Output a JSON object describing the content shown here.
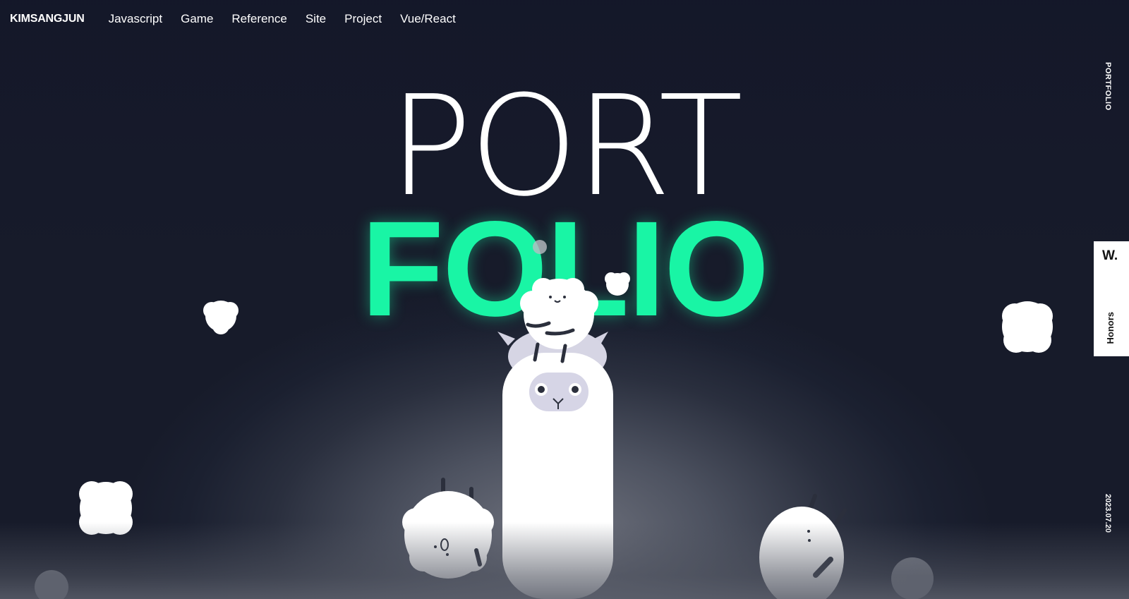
{
  "header": {
    "logo": "KIMSANGJUN",
    "nav": [
      "Javascript",
      "Game",
      "Reference",
      "Site",
      "Project",
      "Vue/React"
    ]
  },
  "side": {
    "portfolio_label": "PORTFOLIO",
    "date": "2023.07.20"
  },
  "honors": {
    "badge": "W.",
    "label": "Honors"
  },
  "hero": {
    "line1": "PORT",
    "line2": "FOLIO"
  },
  "colors": {
    "accent": "#19f5a5",
    "background": "#171b2a",
    "text": "#ffffff"
  }
}
